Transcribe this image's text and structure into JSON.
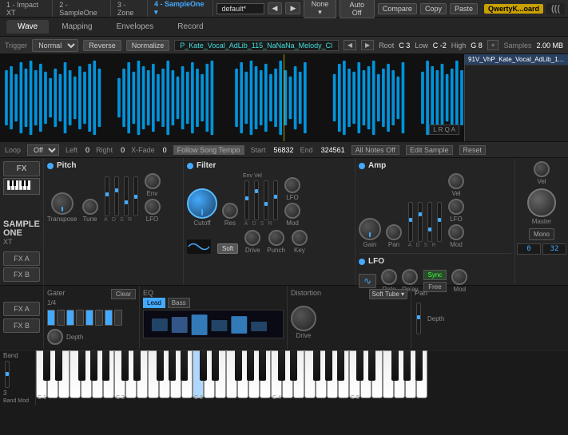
{
  "topbar": {
    "segments": [
      "1 - Impact XT",
      "2 - SampleOne",
      "3 - Zone",
      "4 - SampleOne ▾"
    ],
    "preset": "default*",
    "btns": [
      "Auto Off",
      "Compare",
      "Copy",
      "Paste"
    ],
    "preset_nav": [
      "◀",
      "▶"
    ],
    "none_sel": "None ▾",
    "qwerty": "QwertyK...oard",
    "logo": "((("
  },
  "tabs": {
    "items": [
      "Wave",
      "Mapping",
      "Envelopes",
      "Record"
    ],
    "active": 0
  },
  "controls": {
    "trigger": "Trigger",
    "trigger_val": "Normal ▾",
    "reverse": "Reverse",
    "normalize": "Normalize",
    "filename": "P_Kate_Vocal_AdLib_115_NaNaNa_Melody_Cl",
    "root_label": "Root",
    "root_val": "C 3",
    "low_label": "Low",
    "low_val": "C -2",
    "high_label": "High",
    "high_val": "G 8",
    "plus_btn": "+",
    "samples_label": "Samples",
    "samples_size": "2.00 MB"
  },
  "sample_list": {
    "items": [
      "91V_VhP_Kate_Vocal_AdLib_115_"
    ]
  },
  "loop_row": {
    "loop_label": "Loop",
    "loop_val": "Off ▾",
    "left_label": "Left",
    "left_val": "0",
    "right_label": "Right",
    "right_val": "0",
    "xfade_label": "X-Fade",
    "xfade_val": "0",
    "follow": "Follow Song Tempo",
    "start_label": "Start",
    "start_val": "56832",
    "end_label": "End",
    "end_val": "324561",
    "all_notes_off": "All Notes Off",
    "edit_sample": "Edit Sample",
    "reset": "Reset",
    "lrqa": "L R Q A"
  },
  "pitch": {
    "title": "Pitch",
    "env_label": "Env",
    "lfo_label": "LFO",
    "transpose_label": "Transpose",
    "tune_label": "Tune",
    "adsr": [
      "A",
      "D",
      "S",
      "R"
    ]
  },
  "filter": {
    "title": "Filter",
    "cutoff_label": "Cutoff",
    "res_label": "Res",
    "env_label": "Env",
    "vel_label": "Vel",
    "lfo_label": "LFO",
    "mod_label": "Mod",
    "adsr": [
      "A",
      "D",
      "S",
      "R"
    ],
    "drive_label": "Drive",
    "punch_label": "Punch",
    "key_label": "Key",
    "soft_label": "Soft"
  },
  "amp": {
    "title": "Amp",
    "gain_label": "Gain",
    "pan_label": "Pan",
    "vel_label": "Vel",
    "lfo_label": "LFO",
    "mod_label": "Mod",
    "adsr": [
      "A",
      "D",
      "S",
      "R"
    ]
  },
  "lfo": {
    "title": "LFO",
    "rate_label": "Rate",
    "delay_label": "Delay",
    "mod_label": "Mod",
    "sync_label": "Sync",
    "free_label": "Free"
  },
  "master": {
    "vel_label": "Vel",
    "master_label": "Master",
    "mono_label": "Mono",
    "num_val": "0",
    "num2_val": "32"
  },
  "sample_one": {
    "name": "SAMPLE ONE",
    "xt": "XT"
  },
  "fx_buttons": {
    "fx": "FX",
    "fx_a": "FX A",
    "fx_b": "FX B"
  },
  "gater": {
    "title": "Gater",
    "clear_label": "Clear",
    "steps_label": "1/4",
    "steps": [
      true,
      false,
      true,
      false,
      true,
      false,
      true,
      false
    ]
  },
  "eq": {
    "title": "EQ",
    "lead_label": "Lead",
    "bass_label": "Bass",
    "bands": [
      false,
      true,
      true,
      false,
      true,
      false
    ]
  },
  "distortion": {
    "title": "Distortion",
    "soft_tube": "Soft Tube ▾",
    "drive_label": "Drive"
  },
  "pan_fx": {
    "title": "Pan",
    "depth_label": "Depth"
  },
  "keyboard": {
    "octave_labels": [
      "C 1",
      "C 2",
      "C 3",
      "C 4",
      "C 5"
    ],
    "active_note": "C 3"
  }
}
